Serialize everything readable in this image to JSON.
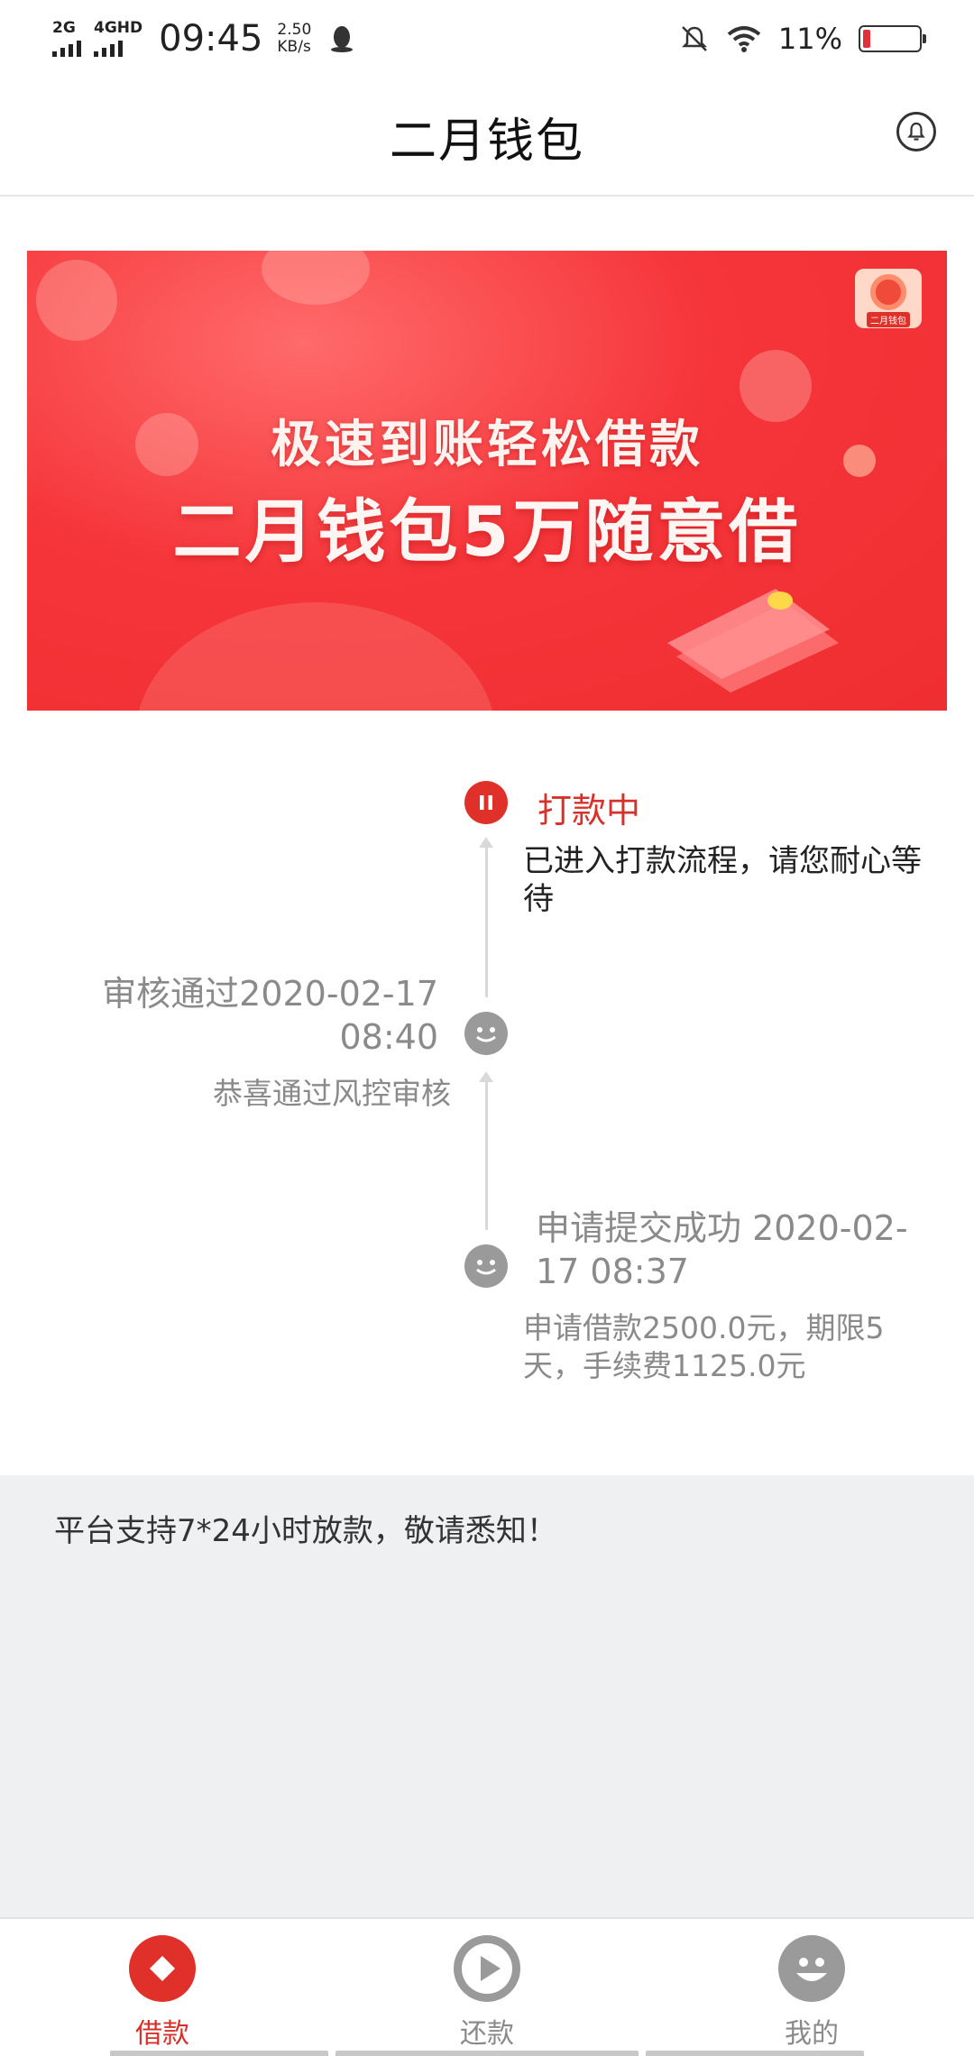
{
  "status_bar": {
    "net1": "2G",
    "net2": "4GHD",
    "time": "09:45",
    "speed_value": "2.50",
    "speed_unit": "KB/s",
    "battery_percent": "11%",
    "battery_level": 0.11
  },
  "header": {
    "title": "二月钱包",
    "bell_icon": "bell-icon"
  },
  "banner": {
    "line1": "极速到账轻松借款",
    "line2": "二月钱包5万随意借",
    "logo_text": "二月钱包"
  },
  "timeline": {
    "step_paying": {
      "title": "打款中",
      "desc": "已进入打款流程，请您耐心等待",
      "icon": "pause-icon",
      "color": "#d8302a"
    },
    "step_approved": {
      "title": "审核通过2020-02-17 08:40",
      "desc": "恭喜通过风控审核",
      "icon": "smiley-icon"
    },
    "step_submitted": {
      "title": "申请提交成功 2020-02-17 08:37",
      "desc": "申请借款2500.0元，期限5天，手续费1125.0元",
      "icon": "smiley-icon"
    }
  },
  "notice": {
    "text": "平台支持7*24小时放款，敬请悉知！"
  },
  "bottom_nav": {
    "items": [
      {
        "label": "借款",
        "icon": "diamond-icon",
        "active": true
      },
      {
        "label": "还款",
        "icon": "play-icon",
        "active": false
      },
      {
        "label": "我的",
        "icon": "smiley-icon",
        "active": false
      }
    ]
  },
  "colors": {
    "accent": "#e0302a",
    "inactive": "#9a9a9a",
    "banner_red": "#f5353a",
    "notice_bg": "#eef0f2"
  }
}
